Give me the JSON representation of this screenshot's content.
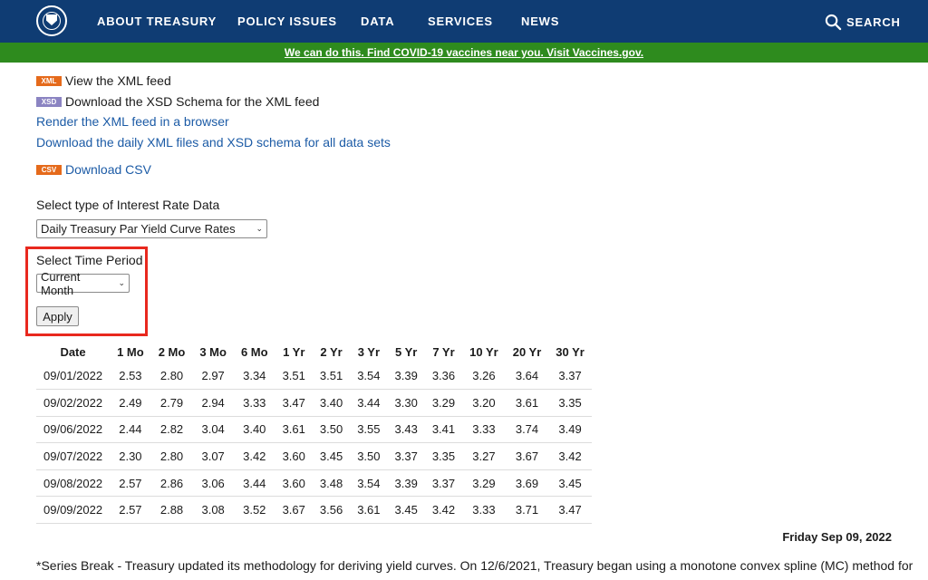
{
  "nav": {
    "items": [
      "ABOUT TREASURY",
      "POLICY ISSUES",
      "DATA",
      "SERVICES",
      "NEWS"
    ],
    "search_label": "SEARCH",
    "background": "#0f3c73"
  },
  "banner": {
    "text": "We can do this. Find COVID-19 vaccines near you. Visit Vaccines.gov.",
    "background": "#2e8b1e"
  },
  "feeds": {
    "xml_badge": "XML",
    "xml_text": "View the XML feed",
    "xsd_badge": "XSD",
    "xsd_text": "Download the XSD Schema for the XML feed",
    "render_link": "Render the XML feed in a browser",
    "daily_link": "Download the daily XML files and XSD schema for all data sets",
    "csv_badge": "CSV",
    "csv_link": "Download CSV"
  },
  "form": {
    "type_label": "Select type of Interest Rate Data",
    "type_value": "Daily Treasury Par Yield Curve Rates",
    "period_label": "Select Time Period",
    "period_value": "Current Month",
    "apply_label": "Apply"
  },
  "table": {
    "headers": [
      "Date",
      "1 Mo",
      "2 Mo",
      "3 Mo",
      "6 Mo",
      "1 Yr",
      "2 Yr",
      "3 Yr",
      "5 Yr",
      "7 Yr",
      "10 Yr",
      "20 Yr",
      "30 Yr"
    ],
    "rows": [
      [
        "09/01/2022",
        "2.53",
        "2.80",
        "2.97",
        "3.34",
        "3.51",
        "3.51",
        "3.54",
        "3.39",
        "3.36",
        "3.26",
        "3.64",
        "3.37"
      ],
      [
        "09/02/2022",
        "2.49",
        "2.79",
        "2.94",
        "3.33",
        "3.47",
        "3.40",
        "3.44",
        "3.30",
        "3.29",
        "3.20",
        "3.61",
        "3.35"
      ],
      [
        "09/06/2022",
        "2.44",
        "2.82",
        "3.04",
        "3.40",
        "3.61",
        "3.50",
        "3.55",
        "3.43",
        "3.41",
        "3.33",
        "3.74",
        "3.49"
      ],
      [
        "09/07/2022",
        "2.30",
        "2.80",
        "3.07",
        "3.42",
        "3.60",
        "3.45",
        "3.50",
        "3.37",
        "3.35",
        "3.27",
        "3.67",
        "3.42"
      ],
      [
        "09/08/2022",
        "2.57",
        "2.86",
        "3.06",
        "3.44",
        "3.60",
        "3.48",
        "3.54",
        "3.39",
        "3.37",
        "3.29",
        "3.69",
        "3.45"
      ],
      [
        "09/09/2022",
        "2.57",
        "2.88",
        "3.08",
        "3.52",
        "3.67",
        "3.56",
        "3.61",
        "3.45",
        "3.42",
        "3.33",
        "3.71",
        "3.47"
      ]
    ]
  },
  "date_stamp": "Friday Sep 09, 2022",
  "footnote": "*Series Break - Treasury updated its methodology for deriving yield curves. On 12/6/2021, Treasury began using a monotone convex spline (MC) method for",
  "colors": {
    "link": "#1c5ba6",
    "badge_orange": "#e56a1b",
    "badge_purple": "#8b84c2",
    "highlight": "#e8281e"
  },
  "icons": {
    "logo": "treasury-seal-icon",
    "search": "search-icon"
  }
}
